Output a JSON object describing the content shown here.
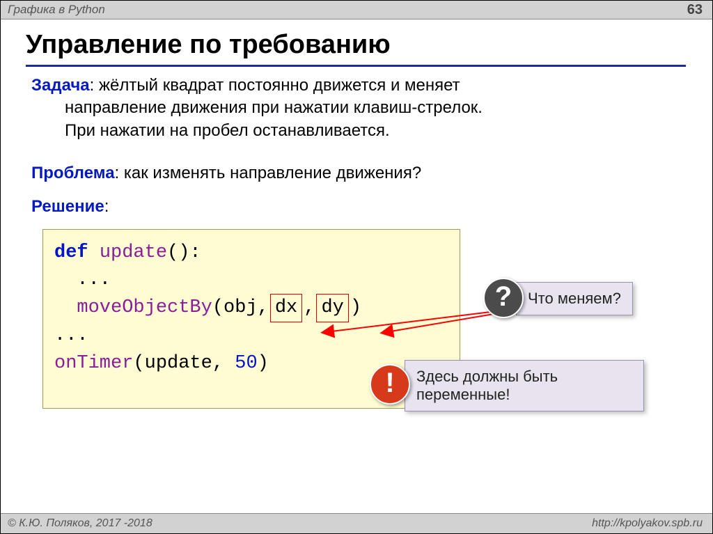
{
  "header": {
    "topic": "Графика в Python",
    "page_number": "63"
  },
  "title": "Управление по требованию",
  "task": {
    "label": "Задача",
    "line1": ": жёлтый квадрат постоянно движется и меняет",
    "line2": "направление движения при нажатии клавиш-стрелок.",
    "line3": "При нажатии на пробел останавливается."
  },
  "problem": {
    "label": "Проблема",
    "text": ": как изменять направление движения?"
  },
  "solution_label": "Решение",
  "code": {
    "l1a": "def ",
    "l1b": "update",
    "l1c": "():",
    "l2": "  ...",
    "l3a": "  moveObjectBy",
    "l3b": "(obj,",
    "l3c": "dx",
    "l3d": ",",
    "l3e": "dy",
    "l3f": ")",
    "l4": "...",
    "l5a": "onTimer",
    "l5b": "(update, ",
    "l5c": "50",
    "l5d": ")"
  },
  "callouts": {
    "question_badge": "?",
    "question_text": "Что меняем?",
    "excl_badge": "!",
    "excl_line1": "Здесь должны быть",
    "excl_line2": "переменные!"
  },
  "footer": {
    "left": "© К.Ю. Поляков, 2017 -2018",
    "right": "http://kpolyakov.spb.ru"
  }
}
